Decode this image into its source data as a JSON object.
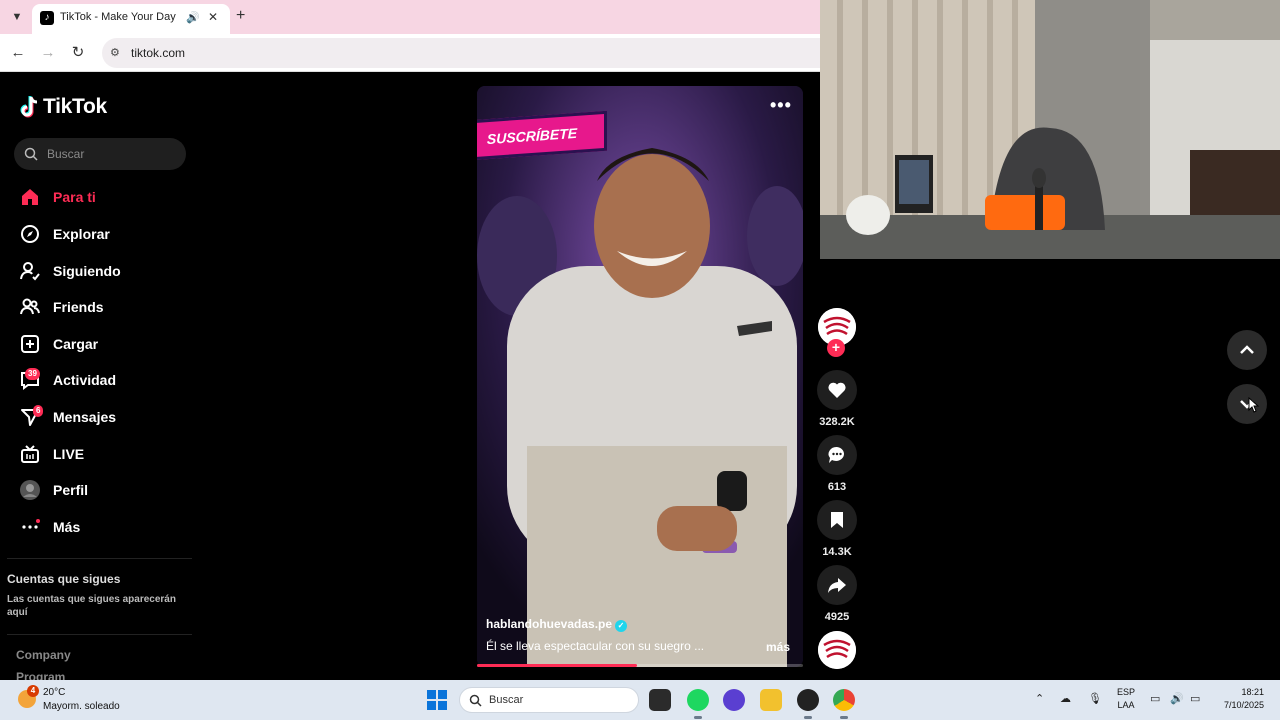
{
  "browser": {
    "tab_title": "TikTok - Make Your Day",
    "url": "tiktok.com",
    "icons": {
      "menu": "chevron-down-icon",
      "audio": "speaker-icon",
      "close": "close-icon",
      "new_tab": "plus-icon",
      "back": "back-arrow-icon",
      "forward": "forward-arrow-icon",
      "reload": "reload-icon",
      "site_info": "site-info-icon"
    }
  },
  "sidebar": {
    "logo_text": "TikTok",
    "search_placeholder": "Buscar",
    "items": [
      {
        "label": "Para ti",
        "icon": "home-icon",
        "active": true
      },
      {
        "label": "Explorar",
        "icon": "compass-icon"
      },
      {
        "label": "Siguiendo",
        "icon": "following-icon"
      },
      {
        "label": "Friends",
        "icon": "friends-icon"
      },
      {
        "label": "Cargar",
        "icon": "upload-icon"
      },
      {
        "label": "Actividad",
        "icon": "activity-icon",
        "badge": "39"
      },
      {
        "label": "Mensajes",
        "icon": "messages-icon",
        "badge": "6"
      },
      {
        "label": "LIVE",
        "icon": "live-icon"
      },
      {
        "label": "Perfil",
        "icon": "profile-avatar"
      },
      {
        "label": "Más",
        "icon": "more-icon"
      }
    ],
    "following_title": "Cuentas que sigues",
    "following_subtitle": "Las cuentas que sigues aparecerán aquí",
    "footer_links": [
      "Company",
      "Program"
    ]
  },
  "video": {
    "overlay_text": "SUSCRÍBETE",
    "author": "hablandohuevadas.pe",
    "caption": "Él se lleva espectacular con su suegro ...",
    "more_label": "más",
    "progress": 0.49,
    "accent_color": "#fe2c55"
  },
  "actions": {
    "likes": "328.2K",
    "comments": "613",
    "saves": "14.3K",
    "shares": "4925"
  },
  "taskbar": {
    "weather_badge": "4",
    "temperature": "20°C",
    "weather_desc": "Mayorm. soleado",
    "search_placeholder": "Buscar",
    "lang_line1": "ESP",
    "lang_line2": "LAA",
    "time": "18:21",
    "date": "7/10/2025"
  }
}
